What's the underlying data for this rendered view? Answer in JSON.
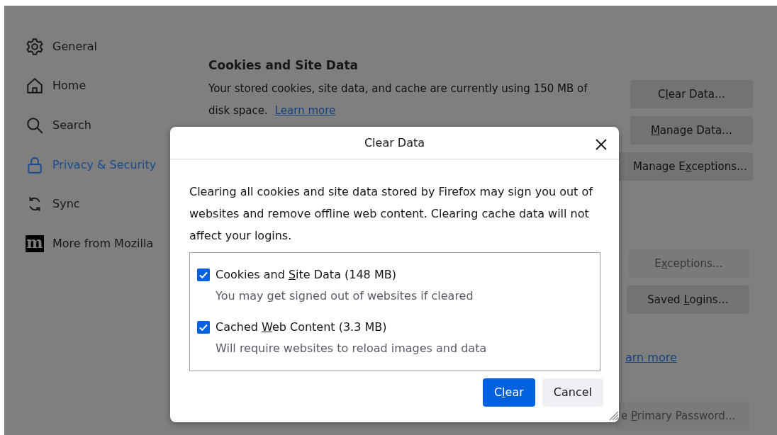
{
  "sidebar": {
    "items": [
      {
        "label": "General",
        "kind": "gear",
        "selected": false
      },
      {
        "label": "Home",
        "kind": "home",
        "selected": false
      },
      {
        "label": "Search",
        "kind": "search",
        "selected": false
      },
      {
        "label": "Privacy & Security",
        "kind": "lock",
        "selected": true
      },
      {
        "label": "Sync",
        "kind": "sync",
        "selected": false
      },
      {
        "label": "More from Mozilla",
        "kind": "logo",
        "logo_text": "m",
        "selected": false
      }
    ]
  },
  "content": {
    "section_title": "Cookies and Site Data",
    "description": "Your stored cookies, site data, and cache are currently using 150 MB of disk space.",
    "learn_more": "Learn more",
    "buttons": [
      {
        "parts": [
          {
            "text": "C",
            "underlined": false
          },
          {
            "text": "l",
            "underlined": true
          },
          {
            "text": "ear Data…",
            "underlined": false
          }
        ],
        "disabled": false
      },
      {
        "parts": [
          {
            "text": "M",
            "underlined": true
          },
          {
            "text": "anage Data…",
            "underlined": false
          }
        ],
        "disabled": false
      },
      {
        "parts": [
          {
            "text": "Manage E",
            "underlined": false
          },
          {
            "text": "x",
            "underlined": true
          },
          {
            "text": "ceptions…",
            "underlined": false
          }
        ],
        "disabled": false
      }
    ],
    "lower_buttons": [
      {
        "parts": [
          {
            "text": "E",
            "underlined": false
          },
          {
            "text": "x",
            "underlined": true
          },
          {
            "text": "ceptions…",
            "underlined": false
          }
        ],
        "disabled": true
      },
      {
        "parts": [
          {
            "text": "Saved ",
            "underlined": false
          },
          {
            "text": "L",
            "underlined": true
          },
          {
            "text": "ogins…",
            "underlined": false
          }
        ],
        "disabled": false
      }
    ],
    "partial_link": "arn more",
    "password_button": {
      "parts": [
        {
          "text": "e ",
          "underlined": false
        },
        {
          "text": "P",
          "underlined": true
        },
        {
          "text": "rimary Password…",
          "underlined": false
        }
      ],
      "disabled": true
    }
  },
  "dialog": {
    "title": "Clear Data",
    "message": "Clearing all cookies and site data stored by Firefox may sign you out of websites and remove offline web content. Clearing cache data will not affect your logins.",
    "options": [
      {
        "parts": [
          {
            "text": "Cookies and ",
            "underlined": false
          },
          {
            "text": "S",
            "underlined": true
          },
          {
            "text": "ite Data (148 MB)",
            "underlined": false
          }
        ],
        "description": "You may get signed out of websites if cleared",
        "checked": true
      },
      {
        "parts": [
          {
            "text": "Cached ",
            "underlined": false
          },
          {
            "text": "W",
            "underlined": true
          },
          {
            "text": "eb Content (3.3 MB)",
            "underlined": false
          }
        ],
        "description": "Will require websites to reload images and data",
        "checked": true
      }
    ],
    "buttons": [
      {
        "parts": [
          {
            "text": "C",
            "underlined": false
          },
          {
            "text": "l",
            "underlined": true
          },
          {
            "text": "ear",
            "underlined": false
          }
        ],
        "kind": "primary"
      },
      {
        "parts": [
          {
            "text": "Cancel",
            "underlined": false
          }
        ],
        "kind": "secondary"
      }
    ]
  }
}
